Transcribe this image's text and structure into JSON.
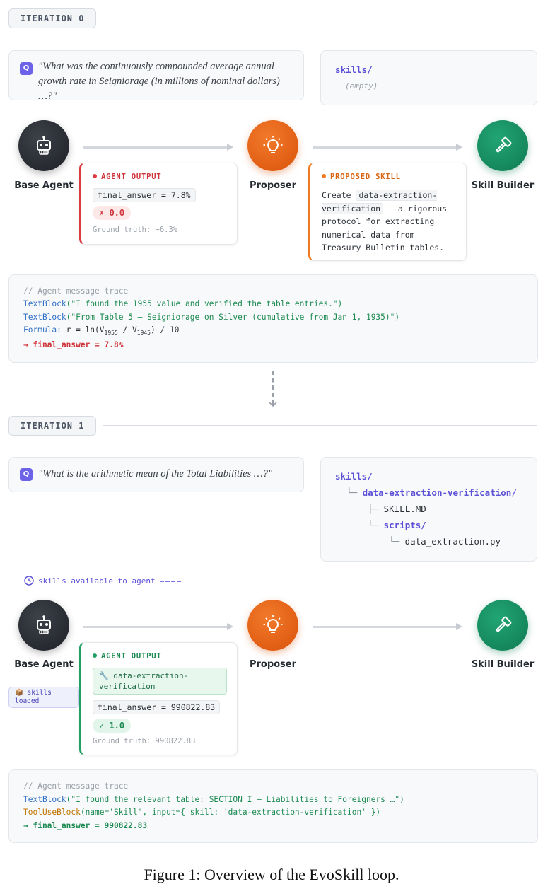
{
  "iteration0": {
    "badge": "ITERATION 0",
    "question": "\"What was the continuously compounded average annual growth rate in Seigniorage (in millions of nominal dollars) …?\"",
    "q_icon": "Q",
    "skills_title": "skills/",
    "skills_empty": "(empty)",
    "nodes": {
      "agent_label": "Base Agent",
      "proposer_label": "Proposer",
      "builder_label": "Skill Builder"
    },
    "agent_output": {
      "heading": "AGENT OUTPUT",
      "answer": "final_answer = 7.8%",
      "score": "✗ 0.0",
      "ground_truth": "Ground truth: −6.3%"
    },
    "proposed_skill": {
      "heading": "PROPOSED SKILL",
      "text_before": "Create ",
      "skill_name": "data-extraction-verification",
      "text_after": " — a rigorous protocol for extracting numerical data from Treasury Bulletin tables."
    },
    "trace": {
      "comment": "// Agent message trace",
      "line1_fn": "TextBlock",
      "line1_arg": "(\"I found the 1955 value and verified the table entries.\")",
      "line2_fn": "TextBlock",
      "line2_arg": "(\"From Table 5 — Seigniorage on Silver (cumulative from Jan 1, 1935)\")",
      "line3_fn": "Formula:",
      "line3_a": " r = ln(V",
      "line3_s1": "1955",
      "line3_b": " / V",
      "line3_s2": "1945",
      "line3_c": ") / 10",
      "result": "→ final_answer = 7.8%"
    }
  },
  "iteration1": {
    "badge": "ITERATION 1",
    "question": "\"What is the arithmetic mean of the Total Liabilities …?\"",
    "q_icon": "Q",
    "skills_tree": {
      "root": "skills/",
      "dir": "data-extraction-verification/",
      "file1": "SKILL.MD",
      "subdir": "scripts/",
      "file2": "data_extraction.py",
      "conn_l": "└─",
      "conn_t": "├─"
    },
    "available_note": "skills available to agent",
    "loaded_badge": "📦 skills loaded",
    "nodes": {
      "agent_label": "Base Agent",
      "proposer_label": "Proposer",
      "builder_label": "Skill Builder"
    },
    "agent_output": {
      "heading": "AGENT OUTPUT",
      "skill_chip": "🔧 data-extraction-verification",
      "answer": "final_answer = 990822.83",
      "score": "✓ 1.0",
      "ground_truth": "Ground truth: 990822.83"
    },
    "trace": {
      "comment": "// Agent message trace",
      "line1_fn": "TextBlock",
      "line1_arg": "(\"I found the relevant table: SECTION I — Liabilities to Foreigners …\")",
      "line2_fn": "ToolUseBlock",
      "line2_arg": "(name='Skill', input={ skill: 'data-extraction-verification' })",
      "result": "→ final_answer = 990822.83"
    }
  },
  "caption": "Figure 1: Overview of the EvoSkill loop.",
  "colors": {
    "agent": "#1d2026",
    "proposer": "#e8621a",
    "builder": "#14895d",
    "accent": "#5b50d6",
    "error": "#dc3b40",
    "success": "#21a065"
  },
  "icons": {
    "agent": "robot-icon",
    "proposer": "lightbulb-icon",
    "builder": "hammer-icon",
    "question": "q-icon",
    "clock": "clock-icon"
  }
}
